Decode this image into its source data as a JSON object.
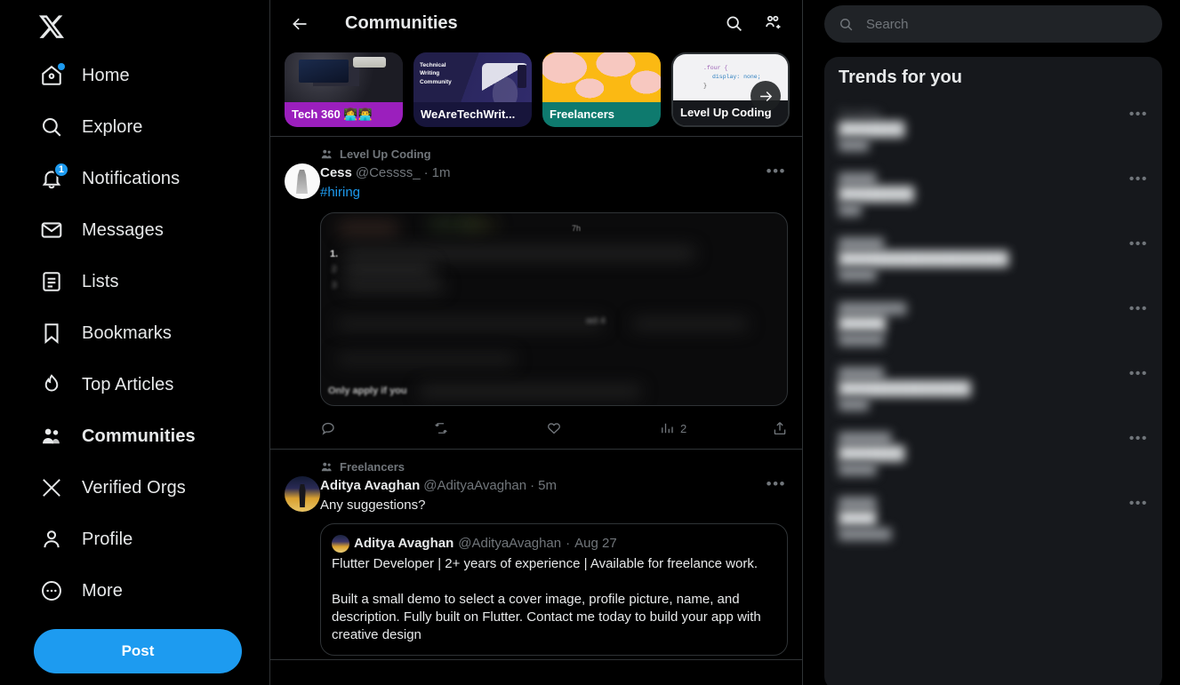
{
  "brand": {
    "logo": "x-logo",
    "accent": "#1d9bf0"
  },
  "sidebar": {
    "items": [
      {
        "label": "Home",
        "icon": "home-icon",
        "badge_dot": true,
        "active": false
      },
      {
        "label": "Explore",
        "icon": "search-icon",
        "badge_dot": false,
        "active": false
      },
      {
        "label": "Notifications",
        "icon": "bell-icon",
        "badge": "1",
        "active": false
      },
      {
        "label": "Messages",
        "icon": "envelope-icon",
        "badge_dot": false,
        "active": false
      },
      {
        "label": "Lists",
        "icon": "list-icon",
        "badge_dot": false,
        "active": false
      },
      {
        "label": "Bookmarks",
        "icon": "bookmark-icon",
        "badge_dot": false,
        "active": false
      },
      {
        "label": "Top Articles",
        "icon": "flame-icon",
        "badge_dot": false,
        "active": false
      },
      {
        "label": "Communities",
        "icon": "communities-icon",
        "badge_dot": false,
        "active": true
      },
      {
        "label": "Verified Orgs",
        "icon": "x-logo-icon",
        "badge_dot": false,
        "active": false
      },
      {
        "label": "Profile",
        "icon": "person-icon",
        "badge_dot": false,
        "active": false
      },
      {
        "label": "More",
        "icon": "more-circle-icon",
        "badge_dot": false,
        "active": false
      }
    ],
    "post_button": "Post"
  },
  "header": {
    "title": "Communities",
    "back_icon": "arrow-left-icon",
    "search_icon": "search-icon",
    "add_people_icon": "add-people-icon"
  },
  "carousel": {
    "next_icon": "arrow-right-icon",
    "cards": [
      {
        "name": "Tech 360 👩‍💻👨‍💻",
        "banner": "workspace-photo",
        "label_bg": "#9b1fbd",
        "selected": false
      },
      {
        "name": "WeAreTechWrit...",
        "banner": "technical-writing-illustration",
        "banner_caption": "Technical\nWriting\nCommunity",
        "label_bg": "#17153b",
        "selected": false
      },
      {
        "name": "Freelancers",
        "banner": "yellow-abstract-pattern",
        "label_bg": "#0e7a6e",
        "selected": false
      },
      {
        "name": "Level Up Coding",
        "banner": "css-code-snippet",
        "code_line_1": ".four {",
        "code_line_2": "display:  none;",
        "code_line_3": "}",
        "label_bg": "#16181c",
        "selected": true
      }
    ]
  },
  "feed": {
    "posts": [
      {
        "community": "Level Up Coding",
        "community_icon": "communities-icon",
        "avatar": "cess-avatar",
        "display_name": "Cess",
        "handle": "@Cessss_",
        "separator": "·",
        "timestamp": "1m",
        "more_icon": "more-horizontal-icon",
        "text": "#hiring",
        "is_hashtag": true,
        "media": {
          "type": "blurred-screenshot",
          "alt": "blurred job posting screenshot",
          "visible_fragments": [
            "1.",
            "2",
            "3",
            "Only apply if you"
          ]
        },
        "actions": {
          "reply": {
            "icon": "reply-icon",
            "count": ""
          },
          "repost": {
            "icon": "repost-icon",
            "count": ""
          },
          "like": {
            "icon": "heart-icon",
            "count": ""
          },
          "views": {
            "icon": "analytics-icon",
            "count": "2"
          },
          "share": {
            "icon": "share-icon",
            "count": ""
          }
        }
      },
      {
        "community": "Freelancers",
        "community_icon": "communities-icon",
        "avatar": "aditya-avatar",
        "display_name": "Aditya Avaghan",
        "handle": "@AdityaAvaghan",
        "separator": "·",
        "timestamp": "5m",
        "more_icon": "more-horizontal-icon",
        "text": "Any suggestions?",
        "quote": {
          "avatar": "aditya-avatar-small",
          "display_name": "Aditya Avaghan",
          "handle": "@AdityaAvaghan",
          "separator": "·",
          "timestamp": "Aug 27",
          "text": "Flutter Developer | 2+ years of experience | Available for freelance work.\n\nBuilt a small demo to select a cover image, profile picture, name, and description. Fully built on Flutter. Contact me today to build your app with creative design"
        }
      }
    ]
  },
  "right": {
    "search": {
      "placeholder": "Search",
      "value": "",
      "icon": "search-icon"
    },
    "trends_title": "Trends for you",
    "trends": [
      {
        "category": "Trending",
        "name": "",
        "count": "",
        "more_icon": "more-horizontal-icon",
        "blurred": true
      },
      {
        "category": "",
        "name": "",
        "count": "",
        "more_icon": "more-horizontal-icon",
        "blurred": true
      },
      {
        "category": "",
        "name": "",
        "count": "",
        "more_icon": "more-horizontal-icon",
        "blurred": true
      },
      {
        "category": "",
        "name": "",
        "count": "",
        "more_icon": "more-horizontal-icon",
        "blurred": true
      },
      {
        "category": "",
        "name": "",
        "count": "",
        "more_icon": "more-horizontal-icon",
        "blurred": true
      },
      {
        "category": "",
        "name": "",
        "count": "",
        "more_icon": "more-horizontal-icon",
        "blurred": true
      },
      {
        "category": "",
        "name": "",
        "count": "",
        "more_icon": "more-horizontal-icon",
        "blurred": true
      }
    ]
  }
}
